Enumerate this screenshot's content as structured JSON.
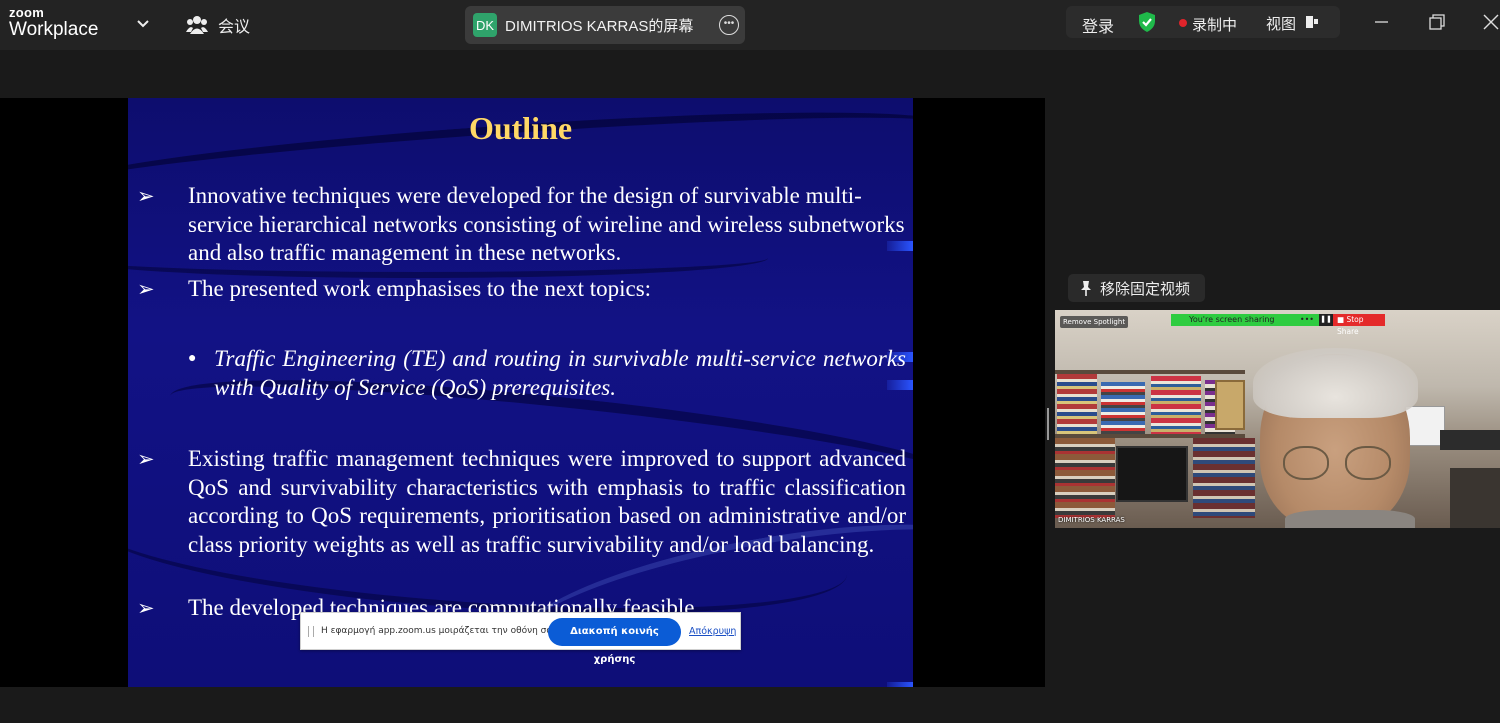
{
  "app": {
    "logo_line1": "zoom",
    "logo_line2": "Workplace",
    "meeting_label": "会议",
    "share_pill": {
      "initials": "DK",
      "label": "DIMITRIOS KARRAS的屏幕",
      "initials_color": "#2fa36b"
    },
    "login_label": "登录",
    "recording_label": "录制中",
    "view_label": "视图",
    "accent_color": "#0b5cd6",
    "record_color": "#e0242b",
    "shield_color": "#1fb94a"
  },
  "slide": {
    "title": "Outline",
    "title_color": "#ffd866",
    "bullet_glyph": "➢",
    "bullets": [
      "Innovative techniques were developed for the design of survivable multi-service hierarchical networks consisting of wireline and wireless subnetworks and also traffic management in these networks.",
      "The presented work emphasises to the next topics:",
      "Existing traffic management techniques were improved to support advanced QoS and survivability characteristics with emphasis to traffic classification according to QoS requirements, prioritisation based on administrative and/or class priority weights as well as traffic survivability and/or load balancing.",
      "The developed techniques are computationally feasible."
    ],
    "sub_bullet_glyph": "●",
    "sub_bullet": "Traffic Engineering (TE) and routing in survivable multi-service networks with Quality of Service (QoS) prerequisites."
  },
  "share_notification": {
    "text": "Η εφαρμογή app.zoom.us μοιράζεται την οθόνη σας.",
    "stop_button": "Διακοπή κοινής χρήσης",
    "hide_link": "Απόκρυψη"
  },
  "video_panel": {
    "unpin_label": "移除固定视频",
    "remove_spotlight": "Remove Spotlight",
    "screen_sharing_text": "You're screen sharing",
    "stop_share": "Stop Share",
    "participant_name": "DIMITRIOS KARRAS"
  }
}
